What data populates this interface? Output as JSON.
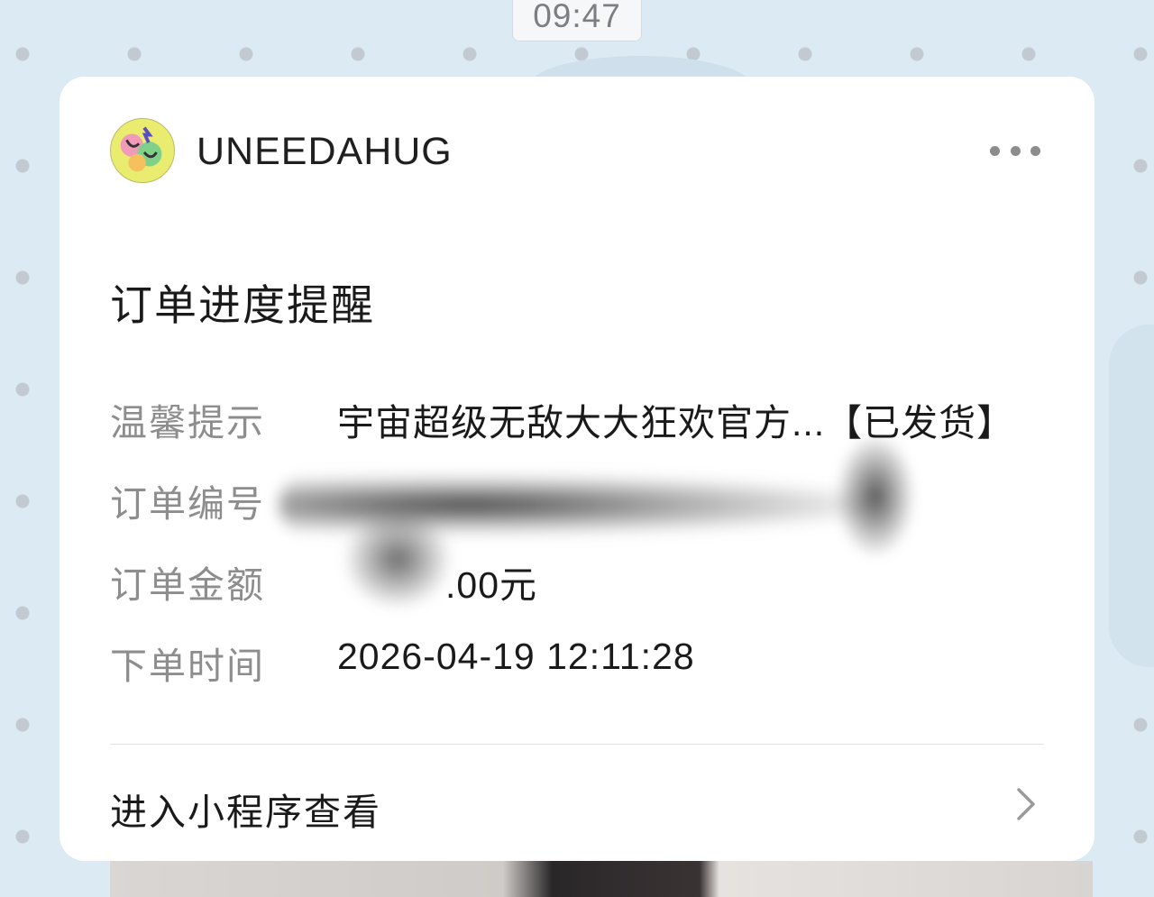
{
  "status_time": "09:47",
  "account": {
    "name": "UNEEDAHUG",
    "avatar_icon": "uneedahug-logo-icon"
  },
  "card": {
    "title": "订单进度提醒",
    "fields": [
      {
        "label": "温馨提示",
        "value": "宇宙超级无敌大大狂欢官方...【已发货】"
      },
      {
        "label": "订单编号",
        "value": ""
      },
      {
        "label": "订单金额",
        "value": ".00元"
      },
      {
        "label": "下单时间",
        "value": "2026-04-19 12:11:28"
      }
    ],
    "footer_link": "进入小程序查看"
  },
  "icons": {
    "more": "more-dots-icon",
    "chevron": "chevron-right-icon"
  },
  "colors": {
    "background": "#dcebf3",
    "card": "#ffffff",
    "label": "#8d8d8d",
    "text": "#1a1a1a"
  }
}
